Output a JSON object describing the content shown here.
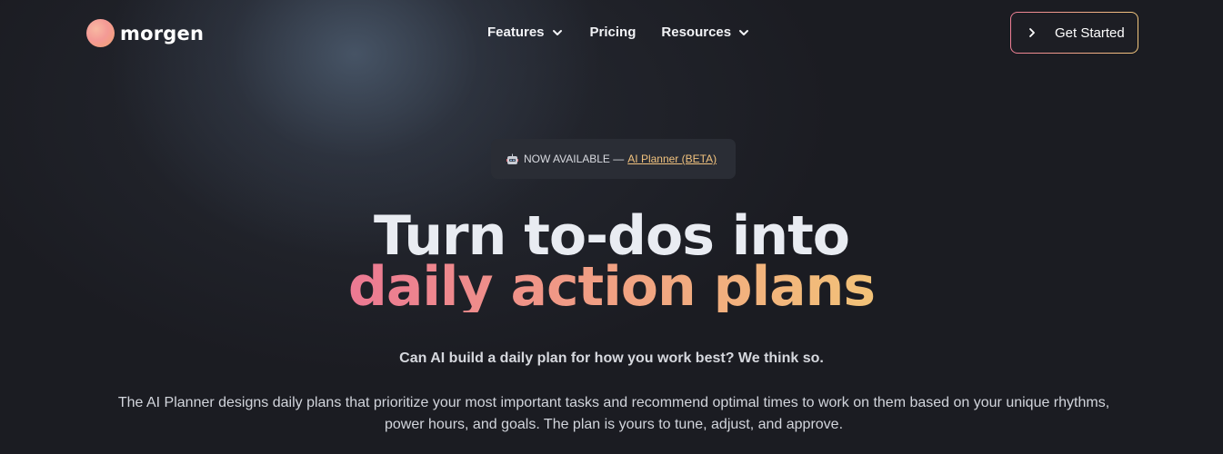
{
  "header": {
    "logo_text": "morgen",
    "nav": [
      {
        "label": "Features",
        "has_dropdown": true,
        "icon": "chevron-down-icon"
      },
      {
        "label": "Pricing",
        "has_dropdown": false
      },
      {
        "label": "Resources",
        "has_dropdown": true,
        "icon": "chevron-down-icon"
      }
    ],
    "cta": {
      "label": "Get Started",
      "icon": "chevron-right-icon"
    }
  },
  "badge": {
    "icon": "robot-icon",
    "text": "NOW AVAILABLE —",
    "link_label": "AI Planner (BETA)"
  },
  "hero": {
    "title_line1": "Turn to-dos into",
    "title_line2": "daily action plans",
    "tagline": "Can AI build a daily plan for how you work best? We think so.",
    "description": "The AI Planner designs daily plans that prioritize your most important tasks and recommend optimal times to work on them based on your unique rhythms, power hours, and goals. The plan is yours to tune, adjust, and approve."
  },
  "colors": {
    "background": "#1b1c22",
    "accent_pink": "#ec7993",
    "accent_gold": "#f2c278",
    "link": "#f1c27e"
  }
}
